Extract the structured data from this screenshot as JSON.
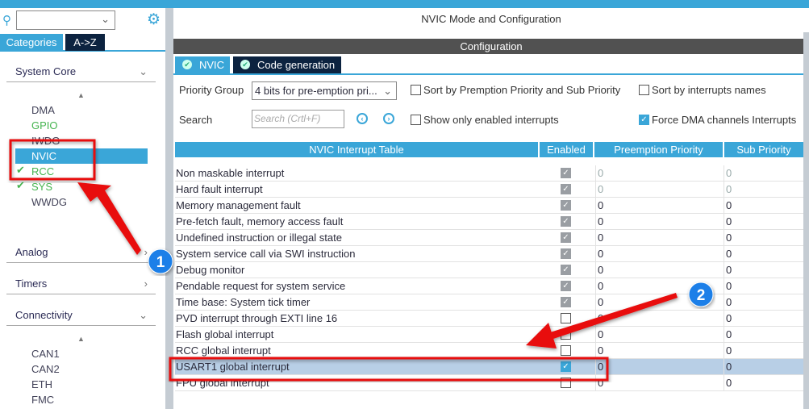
{
  "left": {
    "tabs": [
      "Categories",
      "A->Z"
    ],
    "categories": [
      {
        "label": "System Core",
        "expanded": true,
        "items": [
          {
            "label": "DMA",
            "state": "normal"
          },
          {
            "label": "GPIO",
            "state": "green"
          },
          {
            "label": "IWDG",
            "state": "normal"
          },
          {
            "label": "NVIC",
            "state": "selected"
          },
          {
            "label": "RCC",
            "state": "checked"
          },
          {
            "label": "SYS",
            "state": "checked"
          },
          {
            "label": "WWDG",
            "state": "normal"
          }
        ]
      },
      {
        "label": "Analog",
        "expanded": false
      },
      {
        "label": "Timers",
        "expanded": false
      },
      {
        "label": "Connectivity",
        "expanded": true,
        "items": [
          {
            "label": "CAN1"
          },
          {
            "label": "CAN2"
          },
          {
            "label": "ETH"
          },
          {
            "label": "FMC"
          }
        ]
      }
    ]
  },
  "main": {
    "title": "NVIC Mode and Configuration",
    "config_header": "Configuration",
    "tabs": [
      "NVIC",
      "Code generation"
    ],
    "priority_group_label": "Priority Group",
    "priority_group_value": "4 bits for pre-emption pri...",
    "search_label": "Search",
    "search_placeholder": "Search (Crtl+F)",
    "options": [
      {
        "label": "Sort by Premption Priority and Sub Priority",
        "checked": false
      },
      {
        "label": "Sort by interrupts names",
        "checked": false
      },
      {
        "label": "Show only enabled interrupts",
        "checked": false
      },
      {
        "label": "Force DMA channels Interrupts",
        "checked": true
      }
    ],
    "table": {
      "headers": [
        "NVIC Interrupt Table",
        "Enabled",
        "Preemption Priority",
        "Sub Priority"
      ],
      "rows": [
        {
          "name": "Non maskable interrupt",
          "enabled": "locked",
          "pre": "0",
          "sub": "0",
          "grey": true
        },
        {
          "name": "Hard fault interrupt",
          "enabled": "locked",
          "pre": "0",
          "sub": "0",
          "grey": true
        },
        {
          "name": "Memory management fault",
          "enabled": "locked",
          "pre": "0",
          "sub": "0"
        },
        {
          "name": "Pre-fetch fault, memory access fault",
          "enabled": "locked",
          "pre": "0",
          "sub": "0"
        },
        {
          "name": "Undefined instruction or illegal state",
          "enabled": "locked",
          "pre": "0",
          "sub": "0"
        },
        {
          "name": "System service call via SWI instruction",
          "enabled": "locked",
          "pre": "0",
          "sub": "0"
        },
        {
          "name": "Debug monitor",
          "enabled": "locked",
          "pre": "0",
          "sub": "0"
        },
        {
          "name": "Pendable request for system service",
          "enabled": "locked",
          "pre": "0",
          "sub": "0"
        },
        {
          "name": "Time base: System tick timer",
          "enabled": "locked",
          "pre": "0",
          "sub": "0"
        },
        {
          "name": "PVD interrupt through EXTI line 16",
          "enabled": "off",
          "pre": "0",
          "sub": "0"
        },
        {
          "name": "Flash global interrupt",
          "enabled": "off",
          "pre": "0",
          "sub": "0"
        },
        {
          "name": "RCC global interrupt",
          "enabled": "off",
          "pre": "0",
          "sub": "0"
        },
        {
          "name": "USART1 global interrupt",
          "enabled": "on",
          "pre": "0",
          "sub": "0",
          "selected": true
        },
        {
          "name": "FPU global interrupt",
          "enabled": "off",
          "pre": "0",
          "sub": "0"
        }
      ]
    }
  },
  "annotations": {
    "badges": [
      "1",
      "2"
    ],
    "color": "#e81010",
    "badge_color": "#1a7fe8"
  }
}
